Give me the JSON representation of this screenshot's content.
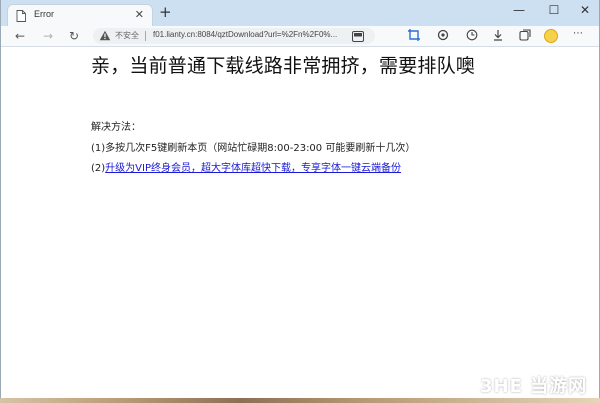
{
  "tab": {
    "title": "Error",
    "close": "✕"
  },
  "new_tab": "+",
  "window_controls": {
    "minimize": "—",
    "maximize": "☐",
    "close": "✕"
  },
  "nav": {
    "back": "←",
    "forward": "→",
    "refresh": "↻"
  },
  "address": {
    "security_label": "不安全",
    "url": "f01.lianty.cn:8084/qztDownload?url=%2Fn%2F0%..."
  },
  "toolbar_icons": [
    "reading-mode-icon",
    "screenshot-icon",
    "extensions-icon",
    "history-icon",
    "downloads-icon",
    "collections-icon",
    "profile-avatar"
  ],
  "menu": "⋯",
  "page": {
    "headline": "亲，当前普通下载线路非常拥挤，需要排队噢",
    "solution_title": "解决方法：",
    "step1": "(1)多按几次F5键刷新本页（网站忙碌期8:00-23:00 可能要刷新十几次）",
    "step2_prefix": "(2)",
    "step2_link": "升级为VIP终身会员，超大字体库超快下载，专享字体一键云端备份"
  },
  "watermark": "3HE 当游网",
  "colors": {
    "link": "#1a1ad8",
    "tabbar": "#cde0f2",
    "toolbar": "#f7f9fb"
  }
}
